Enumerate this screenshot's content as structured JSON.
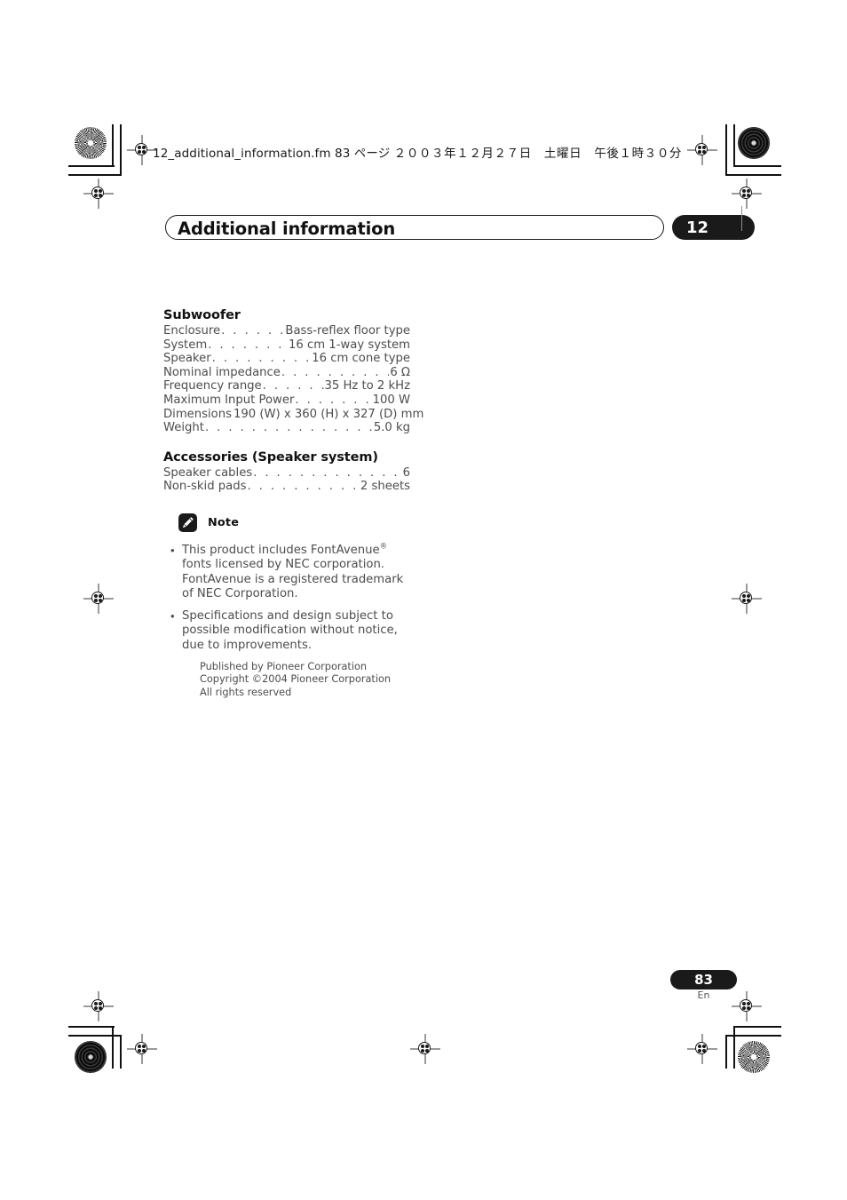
{
  "header": {
    "file_info_ascii": "12_additional_information.fm  83 ページ  ",
    "file_info_jp": "２００３年１２月２７日　土曜日　午後１時３０分"
  },
  "chapter": {
    "title": "Additional information",
    "number": "12"
  },
  "sections": [
    {
      "heading": "Subwoofer",
      "rows": [
        {
          "label": "Enclosure",
          "value": "Bass-reflex floor type",
          "dots": ". . . . . . . . . . . . ."
        },
        {
          "label": "System",
          "value": "16 cm 1-way system",
          "dots": ". . . . . . . . . . . . . . . ."
        },
        {
          "label": "Speaker",
          "value": "16 cm cone type",
          "dots": ". . . . . . . . . . . . . . . . . ."
        },
        {
          "label": "Nominal impedance",
          "value": "6 Ω",
          "dots": ". . . . . . . . . . . . . . . . . . ."
        },
        {
          "label": "Frequency range",
          "value": "35 Hz to 2 kHz",
          "dots": ". . . . . . . . . . . . ."
        },
        {
          "label": "Maximum Input Power",
          "value": "100 W",
          "dots": ". . . . . . . . . . . . . ."
        },
        {
          "label": "Dimensions",
          "value": "190 (W) x 360 (H) x 327 (D) mm",
          "dots": ". . . ."
        },
        {
          "label": "Weight",
          "value": "5.0 kg",
          "dots": ". . . . . . . . . . . . . . . . . . . . . . . . . . ."
        }
      ]
    },
    {
      "heading": "Accessories (Speaker system)",
      "rows": [
        {
          "label": "Speaker cables",
          "value": "6",
          "dots": ". . . . . . . . . . . . . . . . . . . . . . . . . . ."
        },
        {
          "label": "Non-skid pads",
          "value": "2 sheets",
          "dots": ". . . . . . . . . . . . . . . . . . . ."
        }
      ]
    }
  ],
  "note": {
    "icon": "pencil-icon",
    "title": "Note",
    "bullet": "•",
    "items": [
      {
        "text_before": "This product includes FontAvenue",
        "superscript": "®",
        "text_after": " fonts licensed by NEC corporation. FontAvenue is a registered trademark of NEC Corporation."
      },
      {
        "text_before": "Specifications and design subject to possible modification without notice, due to improvements.",
        "superscript": "",
        "text_after": ""
      }
    ]
  },
  "copyright": {
    "line1": "Published by Pioneer Corporation",
    "line2": "Copyright ©2004 Pioneer Corporation",
    "line3": "All rights reserved"
  },
  "footer": {
    "page_number": "83",
    "language": "En"
  },
  "colors": {
    "ink_black": "#1a1a1a",
    "body_gray": "#4d4d4d",
    "paper": "#ffffff",
    "reg_mark_gray": "#9b9b9b"
  }
}
